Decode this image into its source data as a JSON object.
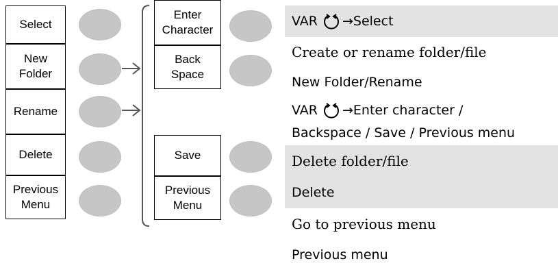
{
  "menu1": {
    "select_label": "Select",
    "new_folder_label": "New\nFolder",
    "rename_label": "Rename",
    "delete_label": "Delete",
    "previous_menu_label": "Previous\nMenu"
  },
  "menu2": {
    "enter_character_label": "Enter\nCharacter",
    "back_space_label": "Back\nSpace",
    "save_label": "Save",
    "previous_menu_label": "Previous\nMenu"
  },
  "descriptions": {
    "select": {
      "prefix": "VAR",
      "suffix": "→Select"
    },
    "new_folder_title": "Create or rename folder/file",
    "new_folder_detail": "New Folder/Rename",
    "rename_line1": {
      "prefix": "VAR",
      "suffix": "→Enter character /"
    },
    "rename_line2": "Backspace / Save / Previous menu",
    "delete_title": "Delete folder/file",
    "delete_detail": "Delete",
    "previous_title": "Go to previous menu",
    "previous_detail": "Previous menu"
  },
  "icons": [
    "variable-knob-icon",
    "arrow-right-icon",
    "bracket"
  ],
  "colors": {
    "knob": "#c6c6c6",
    "shade": "#e3e3e3",
    "border": "#000000",
    "arrow": "#555555"
  }
}
